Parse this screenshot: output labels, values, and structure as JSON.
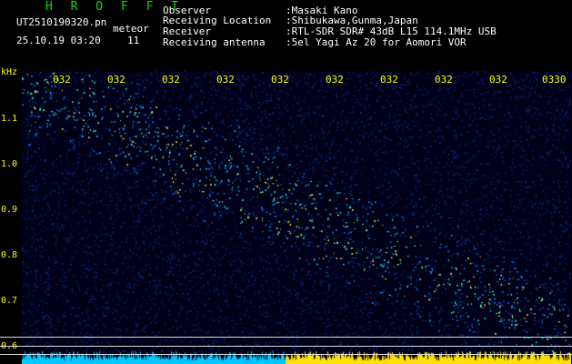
{
  "header": {
    "title": "H R O F F T",
    "filename": "UT2510190320.pn",
    "type": "meteor",
    "datetime": "25.10.19 03:20",
    "count": "11"
  },
  "info": [
    {
      "key": "Observer",
      "value": ":Masaki Kano"
    },
    {
      "key": "Receiving Location",
      "value": ":Shibukawa,Gunma,Japan"
    },
    {
      "key": "Receiver",
      "value": ":RTL-SDR SDR# 43dB L15 114.1MHz USB"
    },
    {
      "key": "Receiving antenna",
      "value": ":5el Yagi Az 20 for Aomori VOR"
    }
  ],
  "axis": {
    "unit": "kHz",
    "y_ticks": [
      "1.1",
      "1.0",
      "0.9",
      "0.8",
      "0.7",
      "0.6"
    ],
    "x_ticks": [
      "032",
      "032",
      "032",
      "032",
      "032",
      "032",
      "032",
      "032",
      "032",
      "0330"
    ]
  },
  "colors": {
    "axis": "#ffff00",
    "title": "#00e000",
    "text": "#ffffff",
    "background": "#000000"
  }
}
